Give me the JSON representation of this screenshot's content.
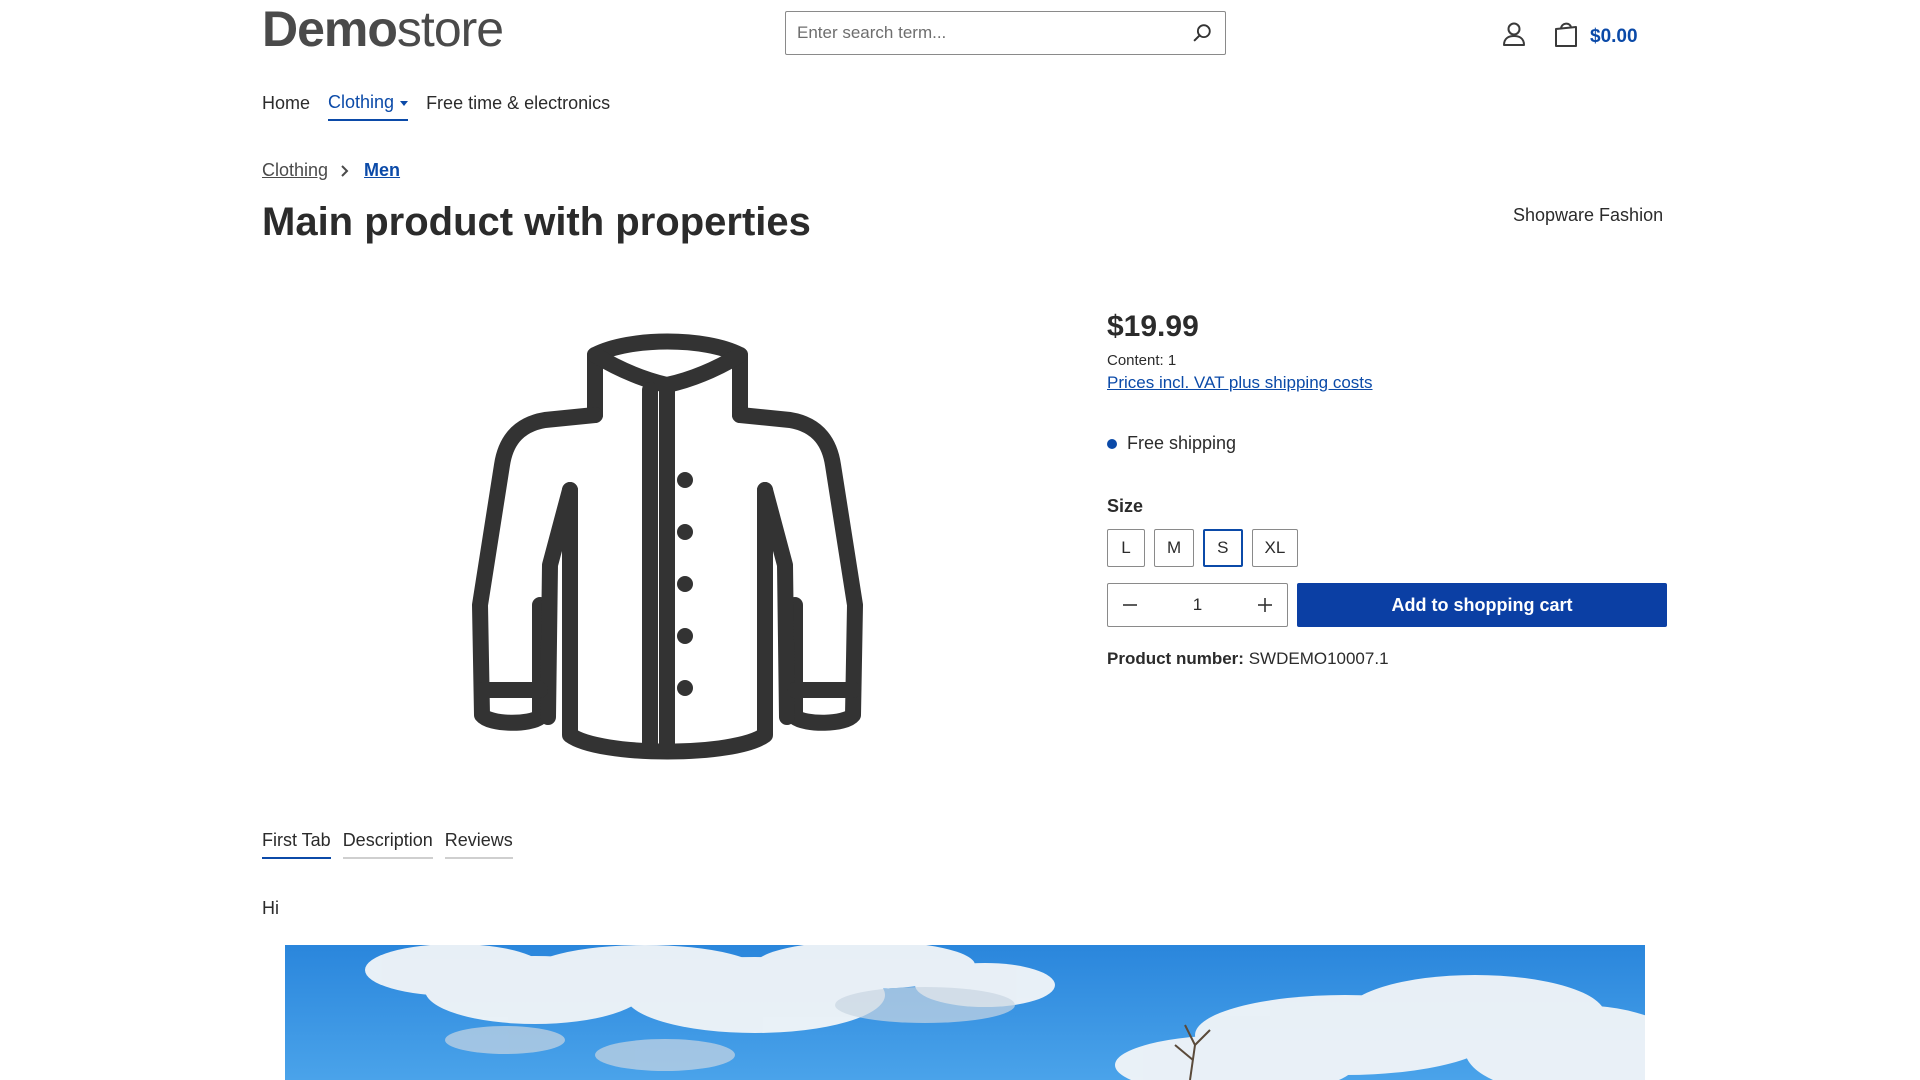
{
  "header": {
    "logo_bold": "Demo",
    "logo_light": "store",
    "search_placeholder": "Enter search term...",
    "cart_total": "$0.00"
  },
  "nav": {
    "items": [
      {
        "label": "Home"
      },
      {
        "label": "Clothing"
      },
      {
        "label": "Free time & electronics"
      }
    ]
  },
  "breadcrumb": {
    "items": [
      {
        "label": "Clothing"
      },
      {
        "label": "Men"
      }
    ]
  },
  "product": {
    "title": "Main product with properties",
    "manufacturer": "Shopware Fashion",
    "price": "$19.99",
    "content": "Content: 1",
    "vat_link": "Prices incl. VAT plus shipping costs",
    "shipping": "Free shipping",
    "size_label": "Size",
    "sizes": [
      "L",
      "M",
      "S",
      "XL"
    ],
    "selected_size": "S",
    "quantity": "1",
    "add_to_cart": "Add to shopping cart",
    "product_number_label": "Product number:",
    "product_number": "SWDEMO10007.1"
  },
  "tabs": {
    "items": [
      {
        "label": "First Tab"
      },
      {
        "label": "Description"
      },
      {
        "label": "Reviews"
      }
    ],
    "content": "Hi"
  },
  "colors": {
    "accent": "#0b4aa8",
    "button": "#0b3fa4"
  }
}
